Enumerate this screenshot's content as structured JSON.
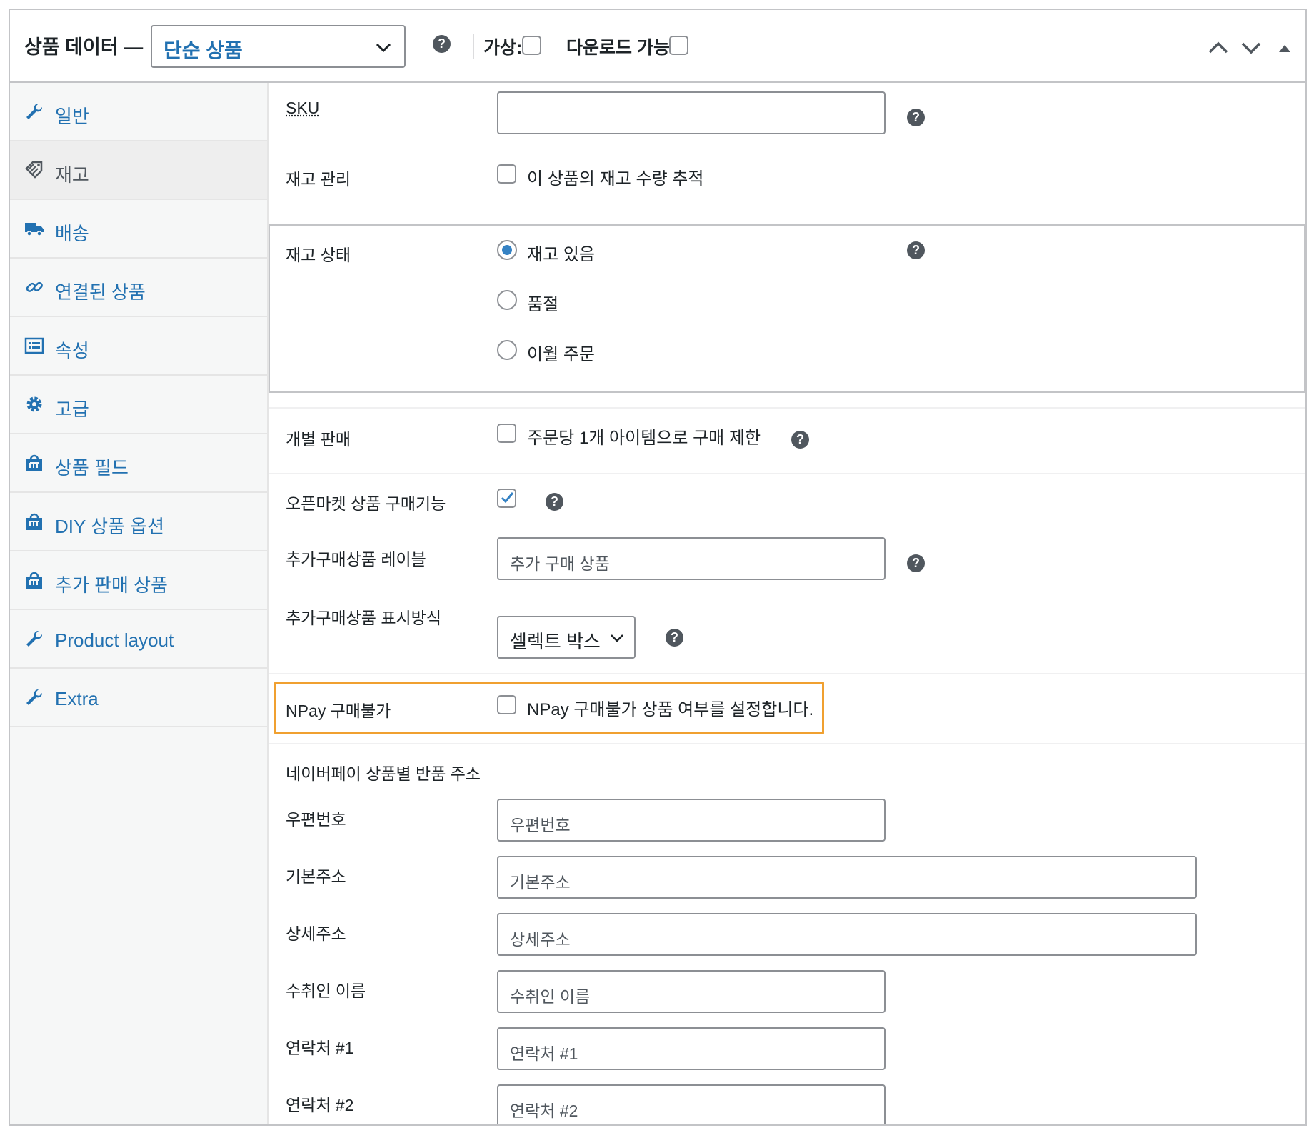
{
  "header": {
    "title": "상품 데이터 —",
    "product_type": "단순 상품",
    "virtual_label": "가상:",
    "downloadable_label": "다운로드 가능:"
  },
  "sidebar": {
    "items": [
      {
        "label": "일반",
        "icon": "wrench-icon"
      },
      {
        "label": "재고",
        "icon": "tag-icon",
        "active": true
      },
      {
        "label": "배송",
        "icon": "truck-icon"
      },
      {
        "label": "연결된 상품",
        "icon": "link-icon"
      },
      {
        "label": "속성",
        "icon": "list-icon"
      },
      {
        "label": "고급",
        "icon": "gear-icon"
      },
      {
        "label": "상품 필드",
        "icon": "shop-bag-icon"
      },
      {
        "label": "DIY 상품 옵션",
        "icon": "shop-bag-icon"
      },
      {
        "label": "추가 판매 상품",
        "icon": "shop-bag-icon"
      },
      {
        "label": "Product layout",
        "icon": "wrench-icon"
      },
      {
        "label": "Extra",
        "icon": "wrench-icon"
      }
    ]
  },
  "inventory": {
    "sku_label": "SKU",
    "sku_value": "",
    "manage_stock_label": "재고 관리",
    "manage_stock_text": "이 상품의 재고 수량 추적",
    "stock_status_label": "재고 상태",
    "stock_options": [
      "재고 있음",
      "품절",
      "이월 주문"
    ],
    "sold_individually_label": "개별 판매",
    "sold_individually_text": "주문당 1개 아이템으로 구매 제한",
    "openmarket_label": "오픈마켓 상품 구매기능",
    "extra_label_label": "추가구매상품 레이블",
    "extra_label_value": "추가 구매 상품",
    "extra_display_label": "추가구매상품 표시방식",
    "extra_display_value": "셀렉트 박스",
    "npay_label": "NPay 구매불가",
    "npay_text": "NPay 구매불가 상품 여부를 설정합니다.",
    "return_section_label": "네이버페이 상품별 반품 주소",
    "postcode_label": "우편번호",
    "postcode_placeholder": "우편번호",
    "address_label": "기본주소",
    "address_placeholder": "기본주소",
    "detail_label": "상세주소",
    "detail_placeholder": "상세주소",
    "recipient_label": "수취인 이름",
    "recipient_placeholder": "수취인 이름",
    "contact1_label": "연락처 #1",
    "contact1_placeholder": "연락처 #1",
    "contact2_label": "연락처 #2",
    "contact2_placeholder": "연락처 #2"
  },
  "colors": {
    "link": "#2271b1",
    "highlight": "#f0a030",
    "radio_checked": "#3582c4"
  }
}
